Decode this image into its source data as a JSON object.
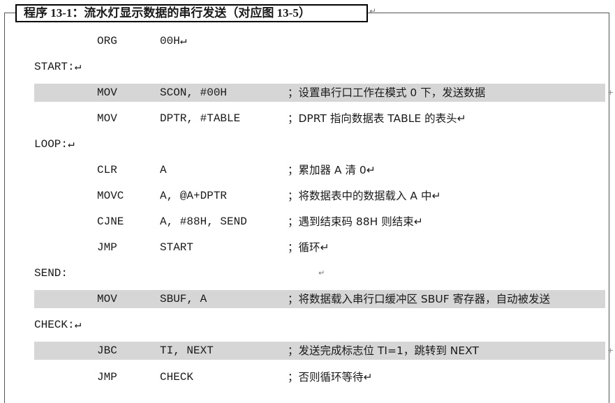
{
  "title": "程序 13-1：流水灯显示数据的串行发送（对应图 13-5）",
  "para_mark": "↵",
  "lines": {
    "org": {
      "op": "ORG",
      "arg": "00H↵"
    },
    "start": {
      "label": "START:↵"
    },
    "mov_scon": {
      "op": "MOV",
      "arg": "SCON, #00H",
      "comment": "；设置串行口工作在模式 0 下，发送数据"
    },
    "mov_dptr": {
      "op": "MOV",
      "arg": "DPTR, #TABLE",
      "comment": "；DPRT 指向数据表 TABLE 的表头↵"
    },
    "loop": {
      "label": "LOOP:↵"
    },
    "clr": {
      "op": "CLR",
      "arg": "A",
      "comment": "；累加器 A 清 0↵"
    },
    "movc": {
      "op": "MOVC",
      "arg": "A, @A+DPTR",
      "comment": "；将数据表中的数据载入 A 中↵"
    },
    "cjne": {
      "op": "CJNE",
      "arg": "A, #88H, SEND",
      "comment": "；遇到结束码 88H 则结束↵"
    },
    "jmp_start": {
      "op": "JMP",
      "arg": "START",
      "comment": "；循环↵"
    },
    "send": {
      "label": "SEND:",
      "trailing": "↵"
    },
    "mov_sbuf": {
      "op": "MOV",
      "arg": "SBUF, A",
      "comment": "；将数据载入串行口缓冲区 SBUF 寄存器，自动被发送"
    },
    "check": {
      "label": "CHECK:↵"
    },
    "jbc": {
      "op": "JBC",
      "arg": "TI, NEXT",
      "comment": "；发送完成标志位 TI=1，跳转到 NEXT"
    },
    "jmp_check": {
      "op": "JMP",
      "arg": "CHECK",
      "comment": "；否则循环等待↵"
    }
  }
}
